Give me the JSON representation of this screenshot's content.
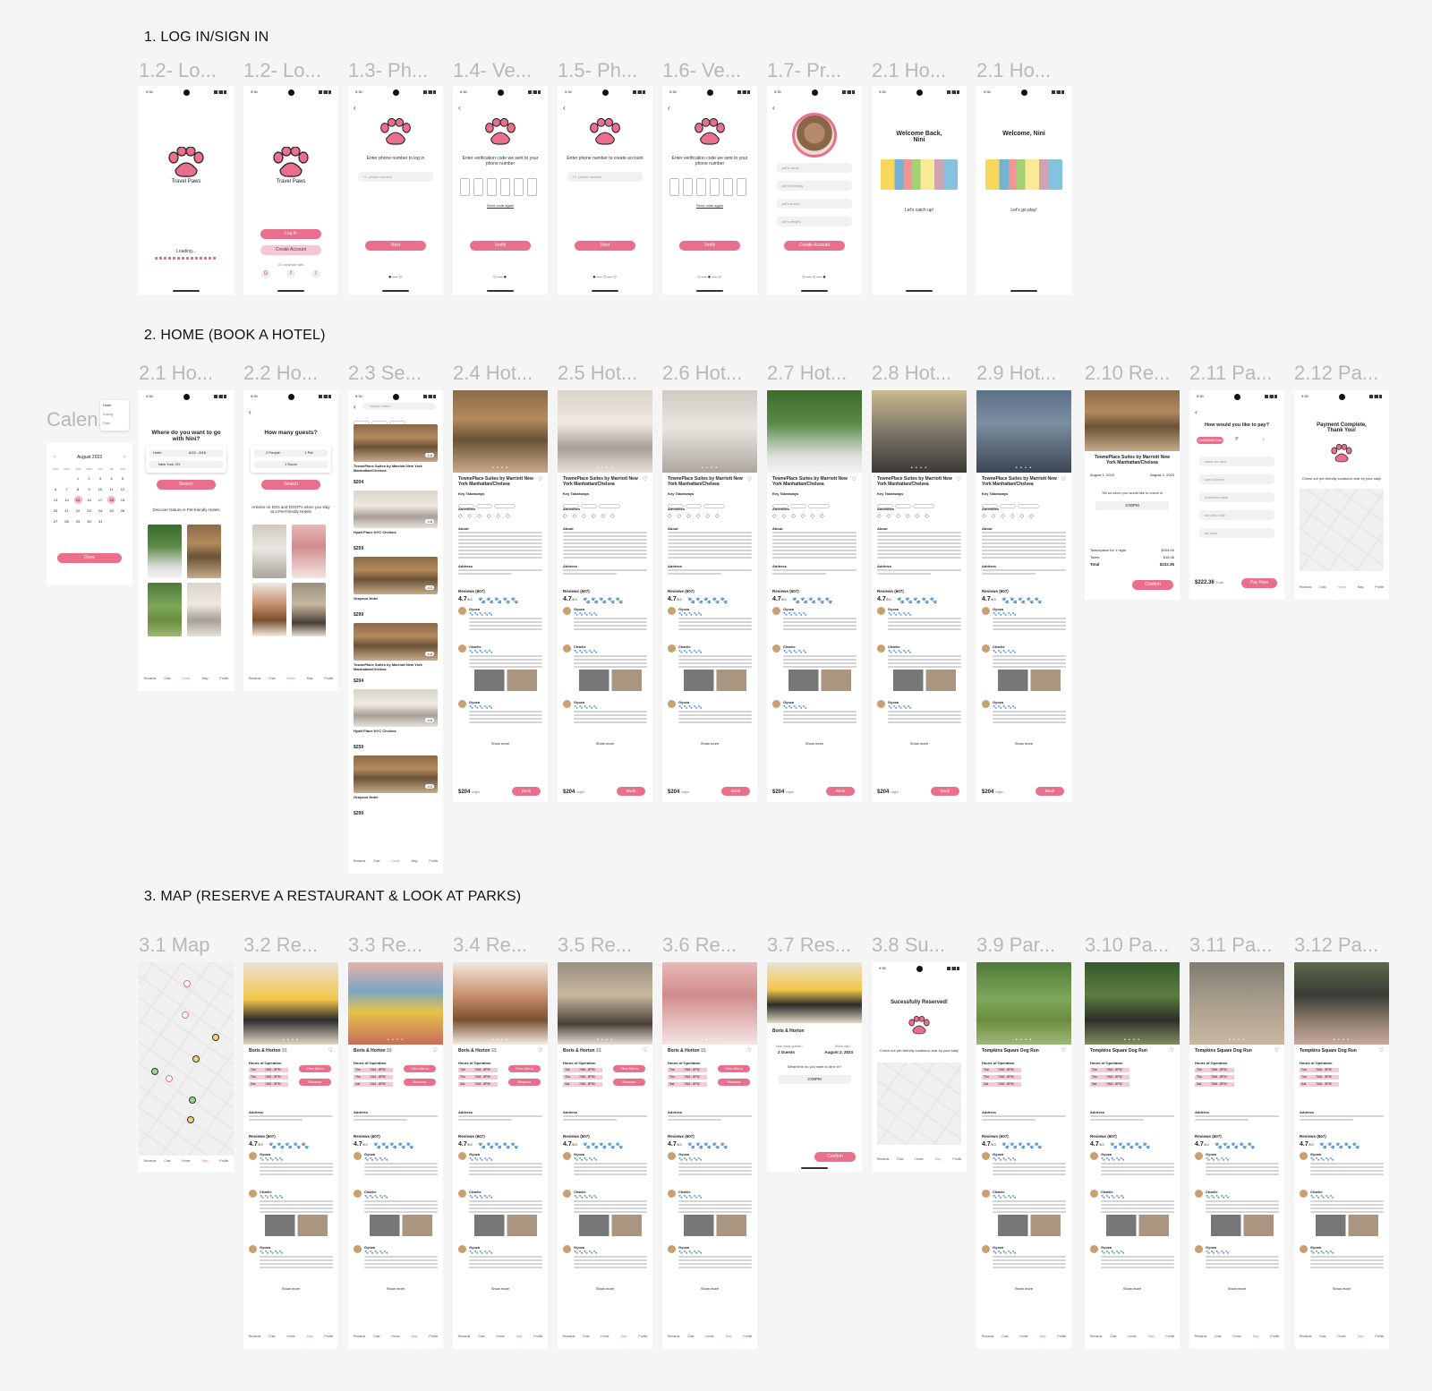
{
  "sections": [
    {
      "title": "1. LOG IN/SIGN IN"
    },
    {
      "title": "2. HOME (BOOK A HOTEL)"
    },
    {
      "title": "3. MAP (RESERVE A RESTAURANT & LOOK AT PARKS)"
    }
  ],
  "row1_labels": [
    "1.2- Lo...",
    "1.2- Lo...",
    "1.3- Ph...",
    "1.4- Ve...",
    "1.5- Ph...",
    "1.6- Ve...",
    "1.7- Pr...",
    "2.1 Ho...",
    "2.1 Ho..."
  ],
  "row2_labels": [
    "2.1 Ho...",
    "2.2 Ho...",
    "2.3 Se...",
    "2.4 Hot...",
    "2.5 Hot...",
    "2.6 Hot...",
    "2.7 Hot...",
    "2.8 Hot...",
    "2.9 Hot...",
    "2.10 Re...",
    "2.11 Pa...",
    "2.12 Pa..."
  ],
  "row3_labels": [
    "3.1 Map",
    "3.2 Re...",
    "3.3 Re...",
    "3.4 Re...",
    "3.5 Re...",
    "3.6 Re...",
    "3.7 Res...",
    "3.8 Su...",
    "3.9 Par...",
    "3.10 Pa...",
    "3.11 Pa...",
    "3.12 Pa..."
  ],
  "calendar_label": "Calen...",
  "status_time": "9:30",
  "login": {
    "app_name": "Travel Paws",
    "loading": "Loading...",
    "log_in": "Log In",
    "create_account": "Create Account",
    "or_continue": "Or continue with",
    "enter_phone_login": "Enter phone number to log in",
    "enter_phone_create": "Enter phone number to create account",
    "phone_placeholder": "phone number",
    "country_code": "+1",
    "verify_prompt": "Enter verification code we sent to your phone number",
    "send_again": "Send code again",
    "next": "Next",
    "verify": "Verify",
    "pet_name": "pet's name",
    "pet_birthday": "pet's birthday",
    "pet_breed": "pet's breed",
    "pet_weight": "pet's weight",
    "create_account_btn": "Create Account",
    "welcome_back": "Welcome Back, Nini",
    "welcome": "Welcome, Nini",
    "catch_up": "Let's catch up!",
    "go_play": "Let's go play!",
    "dots_2": "●—○",
    "dots_2b": "○—●",
    "dots_3": "●—○—○",
    "dots_3b": "○—●—○",
    "dots_3c": "○—○—●"
  },
  "home": {
    "where_prompt": "Where do you want to go with Nini?",
    "how_many": "How many guests?",
    "search": "Search",
    "hotel": "Hotel",
    "dates": "8/15 - 8/16",
    "location": "New York, NY",
    "people": "2 People",
    "pet": "1 Pet",
    "room": "1 Room",
    "discover": "Discover Nature in Pet-friendly Hotels",
    "articles": "Articles on DOs and DONT's when you stay at a Pet-friendly Hotels",
    "search_hint": "Search hotel",
    "hotel_names": [
      "TownePlace Suites by Marriott New York Manhattan/Chelsea",
      "Hyatt Place NYC Chelsea",
      "Grayson Hotel"
    ],
    "list_prices": [
      "$204",
      "$259",
      "$299"
    ],
    "list_ratings": [
      "4.8",
      "4.8",
      "4.2"
    ],
    "hotel_title": "TownePlace Suites by Marriott New York Manhattan/Chelsea",
    "key_takeaways": "Key Takeaways",
    "amenities": "Amenities",
    "about": "About",
    "address": "Address",
    "reviews": "Reviews (607)",
    "rating": "4.7",
    "rating_of": "/5.0",
    "reviewers": [
      "Gyoza",
      "Charlie",
      "Gyoza"
    ],
    "show_more": "Show more",
    "price_night": "$204",
    "per_night": "/night",
    "book": "Book",
    "paws": "🐾🐾🐾🐾🐾"
  },
  "booking": {
    "check_in": "August 1, 2023",
    "check_out": "August 2, 2023",
    "tell_us": "Tell us when you would like to check in",
    "time": "3:00PM",
    "line1_label": "Towneplace for 1 night",
    "line1_value": "$204.00",
    "taxes_label": "Taxes",
    "taxes_value": "$18.36",
    "total_label": "Total",
    "total_value": "$222.36",
    "confirm": "Confirm",
    "pay_prompt": "How would you like to pay?",
    "credit_card": "Credit/Debit Card",
    "name_on_card": "name on card",
    "card_number": "card number",
    "expiration": "expiration date",
    "security": "security code",
    "zip": "zip code",
    "total_price": "$222.36",
    "total_word": "Total",
    "pay_now": "Pay Now",
    "payment_complete": "Payment Complete, Thank You!",
    "check_out_nearby": "Check out pet-friendly locations near by your stay!"
  },
  "calendar": {
    "legend": [
      "Hotel",
      "Dining",
      "Park"
    ],
    "month": "August 2023",
    "weekdays": [
      "SUN",
      "MON",
      "TUE",
      "WED",
      "THU",
      "FRI",
      "SAT"
    ],
    "days": [
      "",
      "",
      "1",
      "2",
      "3",
      "4",
      "5",
      "6",
      "7",
      "8",
      "9",
      "10",
      "11",
      "12",
      "13",
      "14",
      "15",
      "16",
      "17",
      "18",
      "19",
      "20",
      "21",
      "22",
      "23",
      "24",
      "25",
      "26",
      "27",
      "28",
      "29",
      "30",
      "31",
      "",
      ""
    ],
    "done": "Done"
  },
  "map": {
    "restaurant": "Boris & Horton",
    "price_level": "$$",
    "hours": "Hours of Operation",
    "view_menu": "View Menu",
    "reserve": "Reserve",
    "day_rows": [
      "Tue",
      "Thu",
      "Sat"
    ],
    "day_times": [
      "7AM - 8PM",
      "7AM - 8PM",
      "7AM - 8PM"
    ],
    "park": "Tompkins Square Dog Run",
    "how_many_guests": "How many guests?",
    "which_day": "Which day?",
    "guests_value": "2 Guests",
    "day_value": "August 2, 2023",
    "what_time": "What time do you want to dine in?",
    "time_value": "3:00PM",
    "confirm": "Confirm",
    "success": "Sucessfully Reserved!",
    "check_out_nearby": "Check out pet-friendly locations near by your stay!"
  },
  "nav": [
    "Rewards",
    "Chat",
    "Home",
    "Map",
    "Profile"
  ],
  "colors": {
    "accent": "#ea6f8c",
    "accent_light": "#f6c7d2",
    "label_gray": "#b8b8b8"
  }
}
